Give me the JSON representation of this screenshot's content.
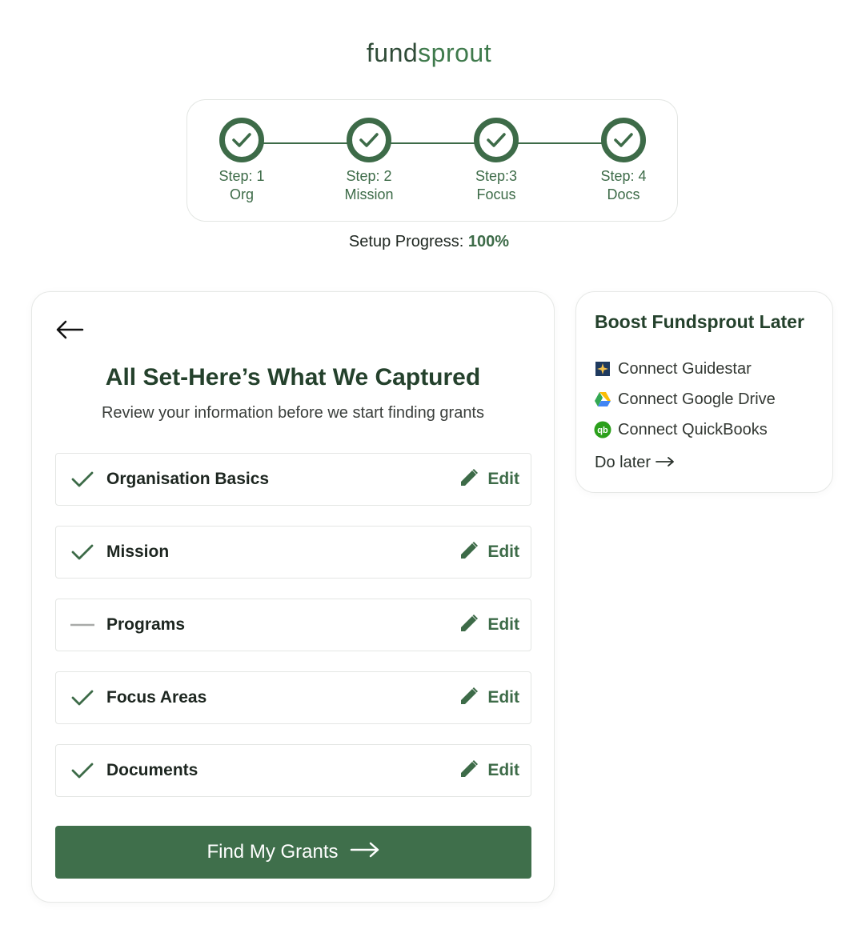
{
  "brand": {
    "part1": "fund",
    "part2": "sprout"
  },
  "stepper": {
    "steps": [
      {
        "line1": "Step: 1",
        "line2": "Org",
        "status": "complete"
      },
      {
        "line1": "Step: 2",
        "line2": "Mission",
        "status": "complete"
      },
      {
        "line1": "Step:3",
        "line2": "Focus",
        "status": "complete"
      },
      {
        "line1": "Step: 4",
        "line2": "Docs",
        "status": "complete"
      }
    ],
    "progress_label": "Setup Progress:",
    "progress_value": "100%"
  },
  "review": {
    "title": "All Set-Here’s What We Captured",
    "subtitle": "Review your information before we start finding grants",
    "items": [
      {
        "label": "Organisation Basics",
        "status": "complete",
        "edit_label": "Edit"
      },
      {
        "label": "Mission",
        "status": "complete",
        "edit_label": "Edit"
      },
      {
        "label": "Programs",
        "status": "skipped",
        "edit_label": "Edit"
      },
      {
        "label": "Focus Areas",
        "status": "complete",
        "edit_label": "Edit"
      },
      {
        "label": "Documents",
        "status": "complete",
        "edit_label": "Edit"
      }
    ],
    "cta_label": "Find My Grants"
  },
  "boost": {
    "title": "Boost Fundsprout Later",
    "items": [
      {
        "label": "Connect Guidestar",
        "icon": "guidestar-icon"
      },
      {
        "label": "Connect Google Drive",
        "icon": "google-drive-icon"
      },
      {
        "label": "Connect QuickBooks",
        "icon": "quickbooks-icon"
      }
    ],
    "do_later_label": "Do later"
  },
  "colors": {
    "primary": "#3d6b48",
    "button": "#3f6f4b",
    "title": "#24412c"
  }
}
